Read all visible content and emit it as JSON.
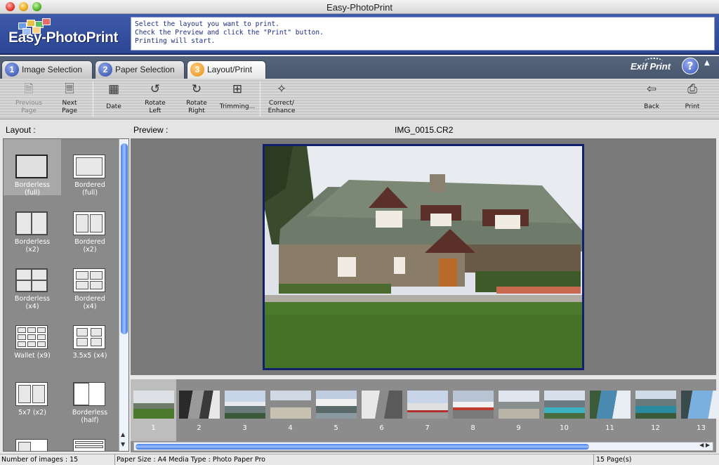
{
  "window": {
    "title": "Easy-PhotoPrint"
  },
  "header": {
    "logo_text": "Easy-PhotoPrint",
    "instructions": [
      "Select the layout you want to print.",
      "Check the Preview and click the \"Print\" button.",
      "Printing will start."
    ]
  },
  "tabs": [
    {
      "num": "1",
      "label": "Image Selection",
      "active": false
    },
    {
      "num": "2",
      "label": "Paper Selection",
      "active": false
    },
    {
      "num": "3",
      "label": "Layout/Print",
      "active": true
    }
  ],
  "branding": {
    "exif": "Exif Print",
    "help": "?"
  },
  "toolbar": {
    "prev": [
      "Previous",
      "Page"
    ],
    "next": [
      "Next",
      "Page"
    ],
    "date": "Date",
    "rotate_left": [
      "Rotate",
      "Left"
    ],
    "rotate_right": [
      "Rotate",
      "Right"
    ],
    "trimming": "Trimming...",
    "correct": [
      "Correct/",
      "Enhance"
    ],
    "back": "Back",
    "print": "Print"
  },
  "sections": {
    "layout": "Layout :",
    "preview": "Preview :",
    "filename": "IMG_0015.CR2"
  },
  "layouts": [
    {
      "name": [
        "Borderless",
        "(full)"
      ],
      "selected": true
    },
    {
      "name": [
        "Bordered",
        "(full)"
      ],
      "selected": false
    },
    {
      "name": [
        "Borderless",
        "(x2)"
      ],
      "selected": false
    },
    {
      "name": [
        "Bordered",
        "(x2)"
      ],
      "selected": false
    },
    {
      "name": [
        "Borderless",
        "(x4)"
      ],
      "selected": false
    },
    {
      "name": [
        "Bordered",
        "(x4)"
      ],
      "selected": false
    },
    {
      "name": [
        "Wallet (x9)",
        ""
      ],
      "selected": false
    },
    {
      "name": [
        "3.5x5 (x4)",
        ""
      ],
      "selected": false
    },
    {
      "name": [
        "5x7 (x2)",
        ""
      ],
      "selected": false
    },
    {
      "name": [
        "Borderless",
        "(half)"
      ],
      "selected": false
    }
  ],
  "thumbnails": [
    "1",
    "2",
    "3",
    "4",
    "5",
    "6",
    "7",
    "8",
    "9",
    "10",
    "11",
    "12",
    "13"
  ],
  "selected_thumbnail": "1",
  "status": {
    "images": "Number of images : 15",
    "paper": "Paper Size : A4 Media Type : Photo Paper Pro",
    "pages": "15 Page(s)"
  }
}
